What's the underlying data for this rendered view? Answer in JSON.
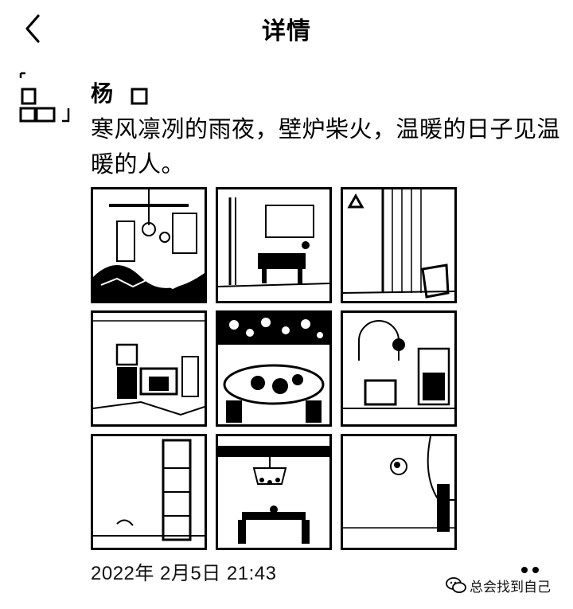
{
  "header": {
    "title": "详情"
  },
  "post": {
    "author": "杨",
    "text": "寒风凛冽的雨夜，壁炉柴火，温暖的日子见温暖的人。",
    "timestamp": "2022年 2月5日 21:43",
    "photos": [
      {
        "label": "living room with chandelier"
      },
      {
        "label": "living room with sofa and windows"
      },
      {
        "label": "room with curtains and rocking chair"
      },
      {
        "label": "fireplace corner"
      },
      {
        "label": "dining table with flowers"
      },
      {
        "label": "room with arched mirror"
      },
      {
        "label": "hallway with shelf"
      },
      {
        "label": "dining room with chandelier"
      },
      {
        "label": "white room with hanging decor"
      }
    ]
  },
  "watermark": {
    "text": "总会找到自己"
  }
}
